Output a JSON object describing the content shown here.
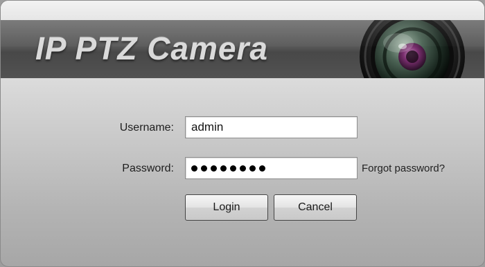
{
  "banner": {
    "title": "IP PTZ Camera",
    "lens_icon": "camera-lens-icon"
  },
  "form": {
    "username_label": "Username:",
    "username_value": "admin",
    "password_label": "Password:",
    "password_mask_count": 8,
    "forgot_link": "Forgot password?"
  },
  "buttons": {
    "login": "Login",
    "cancel": "Cancel"
  },
  "colors": {
    "banner": "#5a5a5a",
    "panel_top": "#e4e4e4",
    "panel_bottom": "#a6a6a6",
    "lens_iris": "#7a2f6f"
  }
}
